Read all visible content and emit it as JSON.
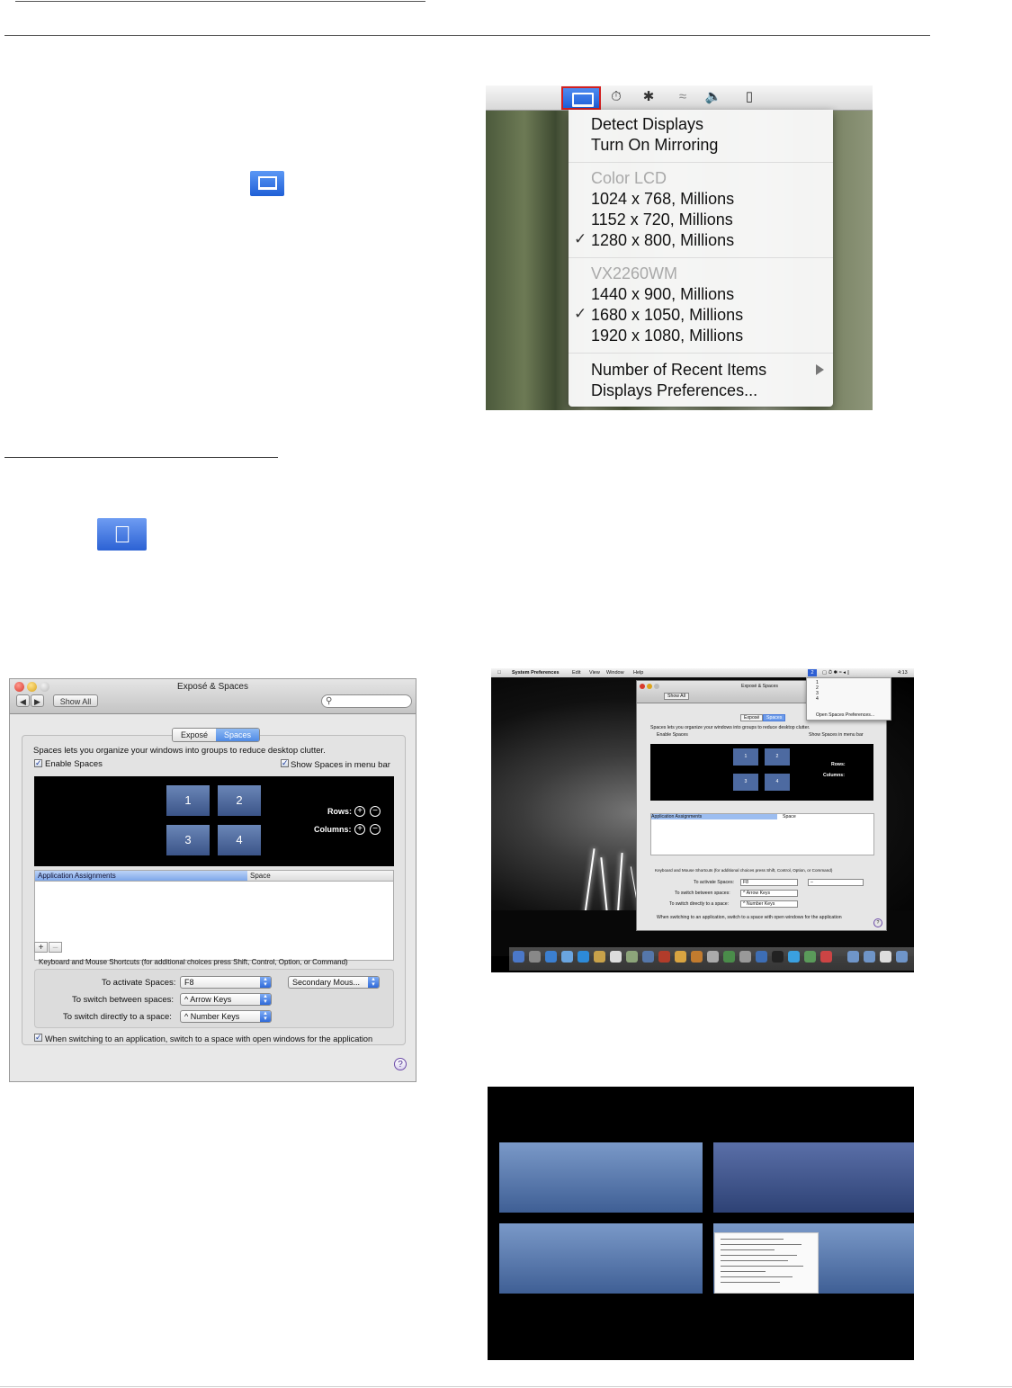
{
  "displays_menu": {
    "items": [
      {
        "label": "Detect Displays"
      },
      {
        "label": "Turn On Mirroring"
      }
    ],
    "groups": [
      {
        "header": "Color LCD",
        "modes": [
          "1024 x 768, Millions",
          "1152 x 720, Millions",
          "1280 x 800, Millions"
        ],
        "checked_index": 2
      },
      {
        "header": "VX2260WM",
        "modes": [
          "1440 x 900, Millions",
          "1680 x 1050, Millions",
          "1920 x 1080, Millions"
        ],
        "checked_index": 1
      }
    ],
    "footer": [
      "Number of Recent Items",
      "Displays Preferences..."
    ],
    "checkmark": "✓",
    "highlight_color": "#d21f1f"
  },
  "pref_window": {
    "title": "Exposé & Spaces",
    "back": "◀",
    "forward": "▶",
    "show_all": "Show All",
    "tabs": [
      "Exposé",
      "Spaces"
    ],
    "selected_tab": 1,
    "description": "Spaces lets you organize your windows into groups to reduce desktop clutter.",
    "enable_spaces": "Enable Spaces",
    "show_in_menubar": "Show Spaces in menu bar",
    "spaces": [
      "1",
      "2",
      "3",
      "4"
    ],
    "rows_label": "Rows:",
    "columns_label": "Columns:",
    "table_headers": [
      "Application Assignments",
      "Space"
    ],
    "plus": "+",
    "minus": "–",
    "shortcuts_caption": "Keyboard and Mouse Shortcuts (for additional choices press Shift, Control, Option, or Command)",
    "activate_label": "To activate Spaces:",
    "activate_value": "F8",
    "activate_mouse": "Secondary Mous...",
    "switch_between_label": "To switch between spaces:",
    "switch_between_value": "^ Arrow Keys",
    "switch_direct_label": "To switch directly to a space:",
    "switch_direct_value": "^ Number Keys",
    "switch_app_option": "When switching to an application, switch to a space with open windows for the application",
    "help": "?"
  },
  "desktop": {
    "menubar": [
      "System Preferences",
      "Edit",
      "View",
      "Window",
      "Help"
    ],
    "clock": "4:13",
    "spaces_menu": [
      "1",
      "2",
      "3",
      "4",
      "Open Spaces Preferences..."
    ],
    "window_title": "Exposé & Spaces",
    "show_all": "Show All",
    "tabs": [
      "Exposé",
      "Spaces"
    ],
    "description": "Spaces lets you organize your windows into groups to reduce desktop clutter.",
    "enable_spaces": "Enable Spaces",
    "show_in_menubar": "Show Spaces in menu bar",
    "spaces": [
      "1",
      "2",
      "3",
      "4"
    ],
    "rows_label": "Rows:",
    "columns_label": "Columns:",
    "table_headers": [
      "Application Assignments",
      "Space"
    ],
    "shortcuts_caption": "Keyboard and Mouse Shortcuts (for additional choices press Shift, Control, Option, or Command)",
    "activate_label": "To activate Spaces:",
    "activate_value": "F8",
    "activate_mouse": "–",
    "switch_between_label": "To switch between spaces:",
    "switch_between_value": "^ Arrow Keys",
    "switch_direct_label": "To switch directly to a space:",
    "switch_direct_value": "^ Number Keys",
    "switch_app_option": "When switching to an application, switch to a space with open windows for the application"
  }
}
